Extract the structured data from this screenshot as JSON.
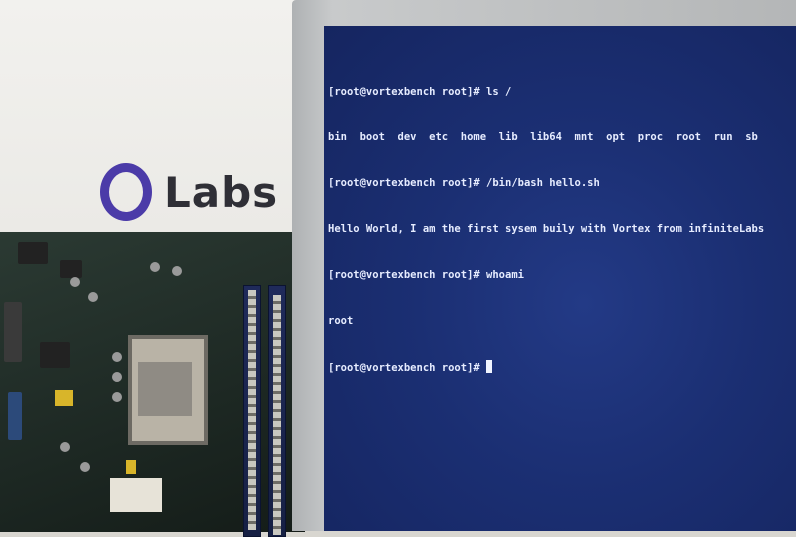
{
  "poster": {
    "logo_text": "Labs"
  },
  "terminal": {
    "lines": [
      "[root@vortexbench root]# ls /",
      "bin  boot  dev  etc  home  lib  lib64  mnt  opt  proc  root  run  sb",
      "[root@vortexbench root]# /bin/bash hello.sh",
      "Hello World, I am the first sysem buily with Vortex from infiniteLabs",
      "[root@vortexbench root]# whoami",
      "root",
      "[root@vortexbench root]# "
    ]
  },
  "colors": {
    "logo_ring": "#4b3ba8",
    "screen_bg": "#1b2f73",
    "terminal_text": "#e6ecff"
  }
}
